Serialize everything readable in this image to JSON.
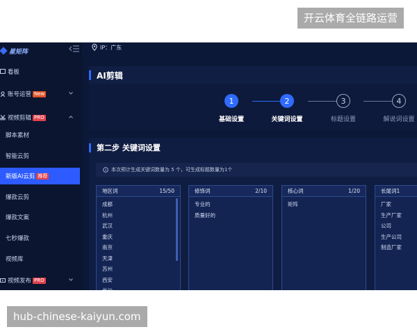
{
  "watermark": {
    "top": "开云体育全链路运营",
    "bottom": "hub-chinese-kaiyun.com"
  },
  "logo": {
    "text": "星矩阵"
  },
  "sidebar": {
    "items": [
      {
        "label": "看板",
        "icon": "dashboard-icon"
      },
      {
        "label": "账号运营",
        "tag": "New",
        "icon": "account-icon",
        "expandable": true
      },
      {
        "label": "视频剪辑",
        "tag": "PRO",
        "icon": "scissors-icon",
        "expandable": true
      },
      {
        "label": "脚本素材"
      },
      {
        "label": "智能云剪"
      },
      {
        "label": "新版AI云剪",
        "tag": "推荐",
        "active": true
      },
      {
        "label": "爆款云剪"
      },
      {
        "label": "爆款文案"
      },
      {
        "label": "七秒爆款"
      },
      {
        "label": "视频库"
      },
      {
        "label": "视频发布",
        "tag": "PRO",
        "icon": "video-icon",
        "expandable": true
      }
    ]
  },
  "location": {
    "text": "IP：广东"
  },
  "page": {
    "title": "AI剪辑"
  },
  "steps": [
    {
      "num": "1",
      "label": "基础设置",
      "state": "done"
    },
    {
      "num": "2",
      "label": "关键词设置",
      "state": "active"
    },
    {
      "num": "3",
      "label": "标题设置",
      "state": "pending"
    },
    {
      "num": "4",
      "label": "解说词设置",
      "state": "pending"
    }
  ],
  "section": {
    "title": "第二步 关键词设置",
    "notice": "本次预计生成关键词数量为 5 个，可生成标题数量为1个"
  },
  "columns": [
    {
      "name": "地区词",
      "count": "15/50",
      "items": [
        "成都",
        "杭州",
        "武汉",
        "重庆",
        "南京",
        "天津",
        "苏州",
        "西安",
        "长沙"
      ]
    },
    {
      "name": "修饰词",
      "count": "2/10",
      "items": [
        "专业的",
        "质量好的"
      ]
    },
    {
      "name": "核心词",
      "count": "1/20",
      "items": [
        "矩阵"
      ]
    },
    {
      "name": "长尾词1",
      "count": "",
      "items": [
        "厂家",
        "生产厂家",
        "公司",
        "生产公司",
        "制造厂家"
      ]
    }
  ],
  "colors": {
    "accent": "#2d5bff",
    "app_bg": "#0c1838",
    "sidebar_bg": "#0b1530",
    "tag_orange": "#e0542a",
    "tag_red": "#e2424c"
  }
}
